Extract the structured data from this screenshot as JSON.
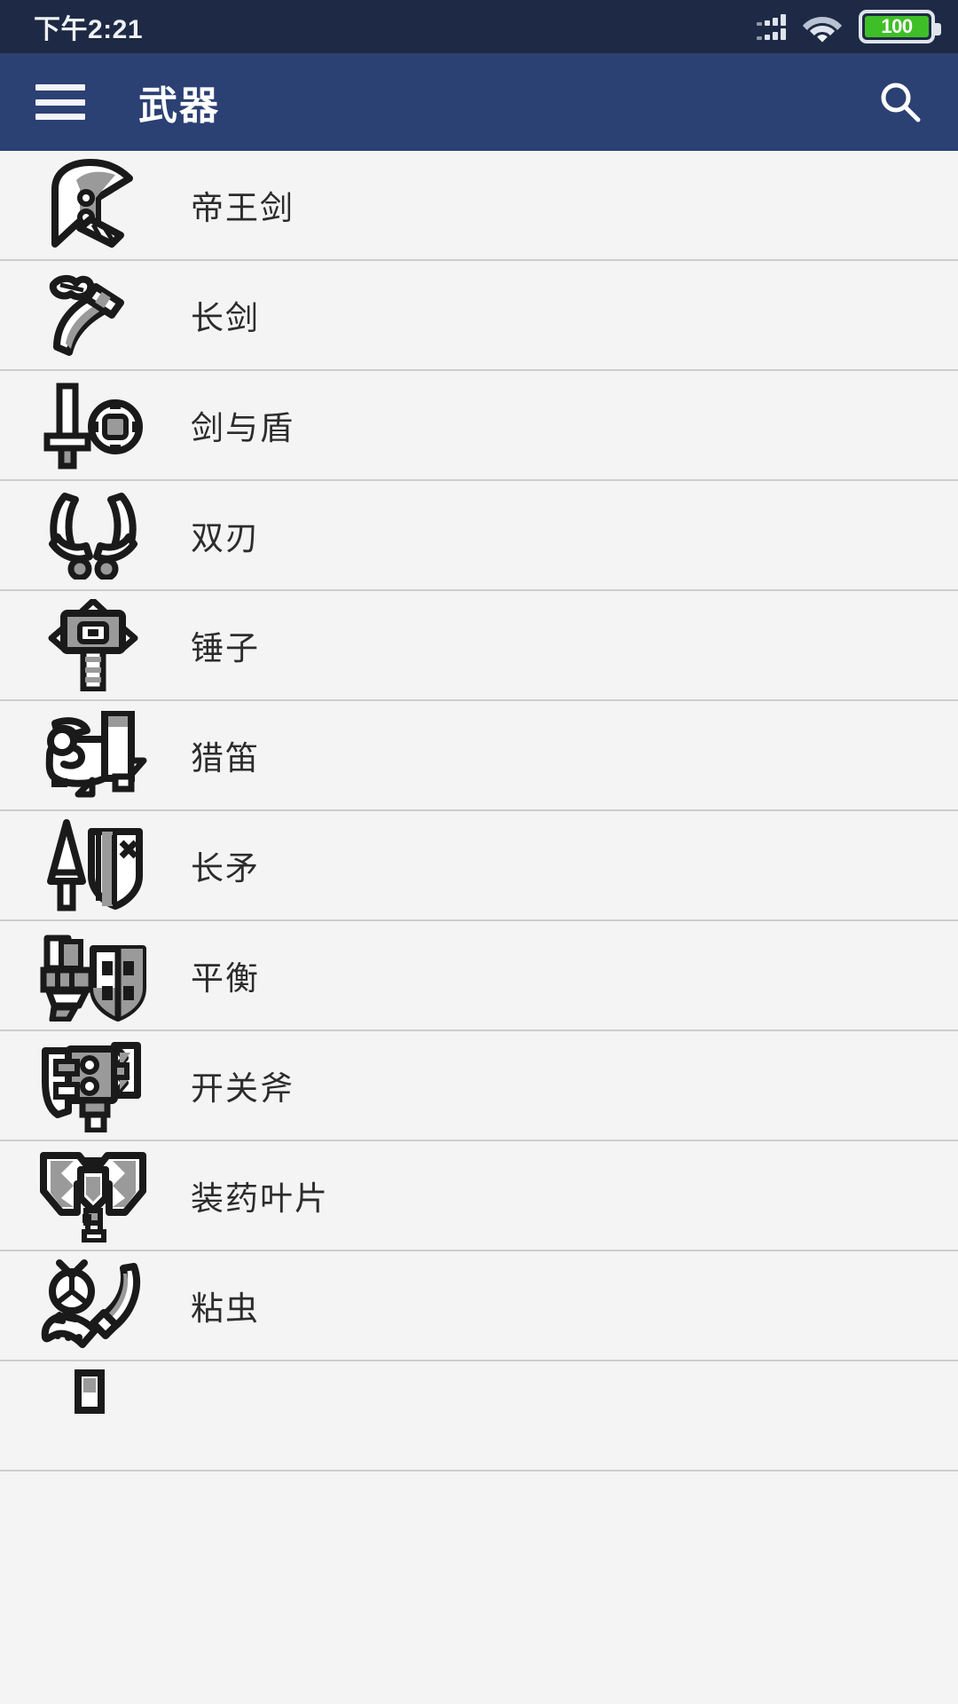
{
  "status_bar": {
    "time": "下午2:21",
    "signal_icon": "signal-bars-dual-icon",
    "wifi_icon": "wifi-icon",
    "battery_icon": "battery-icon",
    "battery_level": "100",
    "bg_color": "#1e2a45",
    "battery_fill_color": "#3fbf27"
  },
  "app_bar": {
    "menu_icon": "hamburger-menu-icon",
    "title": "武器",
    "search_icon": "search-icon",
    "bg_color": "#2b4073",
    "text_color": "#ffffff"
  },
  "list": {
    "separator_color": "#cdcdcd",
    "row_bg_color": "#f4f4f4",
    "items": [
      {
        "label": "帝王剑",
        "icon": "great-sword-icon"
      },
      {
        "label": "长剑",
        "icon": "long-sword-icon"
      },
      {
        "label": "剑与盾",
        "icon": "sword-and-shield-icon"
      },
      {
        "label": "双刃",
        "icon": "dual-blades-icon"
      },
      {
        "label": "锤子",
        "icon": "hammer-icon"
      },
      {
        "label": "猎笛",
        "icon": "hunting-horn-icon"
      },
      {
        "label": "长矛",
        "icon": "lance-icon"
      },
      {
        "label": "平衡",
        "icon": "gunlance-icon"
      },
      {
        "label": "开关斧",
        "icon": "switch-axe-icon"
      },
      {
        "label": "装药叶片",
        "icon": "charge-blade-icon"
      },
      {
        "label": "粘虫",
        "icon": "insect-glaive-icon"
      },
      {
        "label": "",
        "icon": "bowgun-icon"
      }
    ]
  }
}
